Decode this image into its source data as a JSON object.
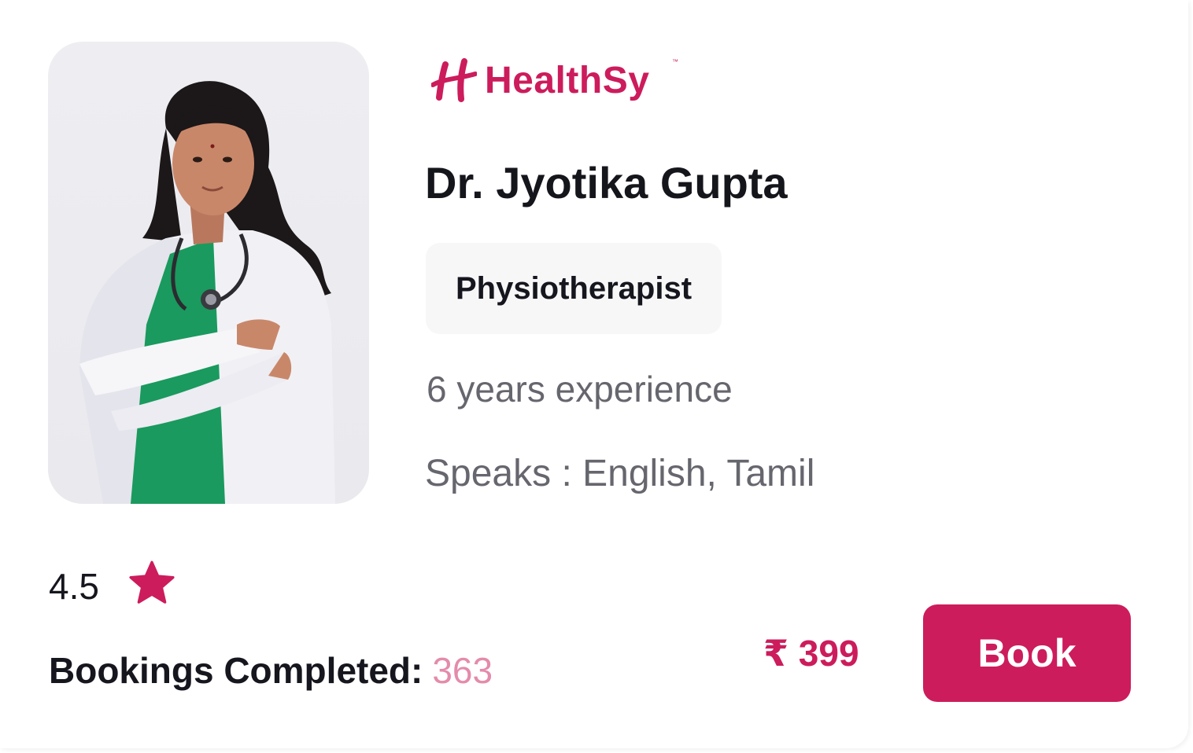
{
  "brand": {
    "name": "HealthSy",
    "trademark": "™",
    "color": "#cc1c5c"
  },
  "doctor": {
    "name": "Dr. Jyotika Gupta",
    "specialty": "Physiotherapist",
    "experience": "6 years experience",
    "languages": "Speaks : English, Tamil",
    "photo_icon": "doctor-photo"
  },
  "stats": {
    "rating": "4.5",
    "rating_icon": "star-icon",
    "bookings_label": "Bookings Completed:",
    "bookings_count": "363"
  },
  "pricing": {
    "price": "₹ 399",
    "book_label": "Book"
  },
  "colors": {
    "accent": "#cc1c5c",
    "bookings_count": "#e48bab",
    "text_primary": "#16161e",
    "text_secondary": "#66666e",
    "chip_bg": "#f7f7f8"
  }
}
